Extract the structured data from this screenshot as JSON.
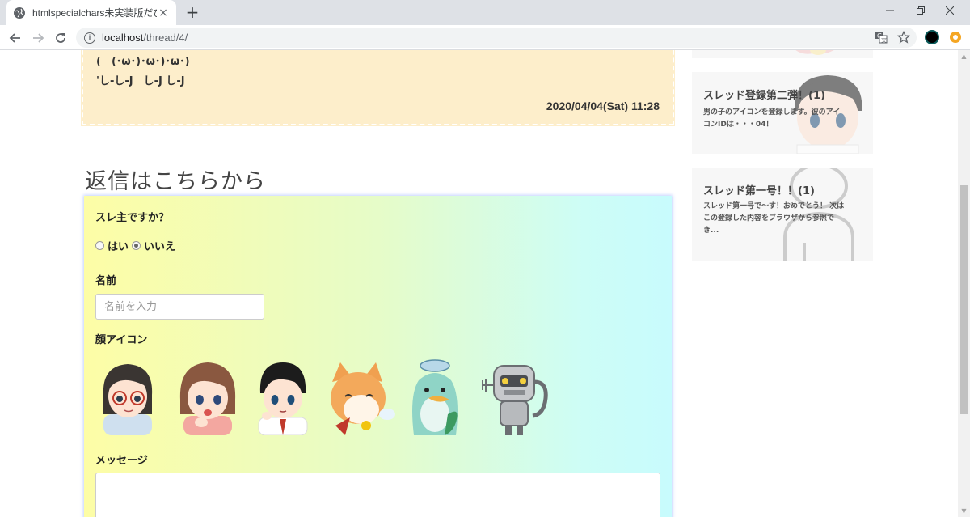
{
  "browser": {
    "tab_title": "htmlspecialchars未実装版だびぃ",
    "tab_close": "×",
    "new_tab": "+",
    "url_host": "localhost",
    "url_path": "/thread/4/",
    "icons": [
      "globe-icon",
      "back-icon",
      "forward-icon",
      "reload-icon",
      "info-icon",
      "translate-icon",
      "star-icon",
      "profile-icon",
      "extension-icon",
      "minimize-icon",
      "restore-icon",
      "close-icon"
    ]
  },
  "post": {
    "lines": [
      "(　(･ω･)･ω･)･ω･)",
      "'し-し-J　し-J し-J"
    ],
    "date": "2020/04/04(Sat) 11:28"
  },
  "reply": {
    "heading": "返信はこちらから",
    "owner_question": "スレ主ですか？",
    "radio_yes": "はい",
    "radio_no": "いいえ",
    "selected": "いいえ",
    "name_label": "名前",
    "name_placeholder": "名前を入力",
    "icon_label": "顔アイコン",
    "avatars": [
      "girl-glasses",
      "girl-brown-hair",
      "boy-black-hair",
      "orange-cat",
      "blue-bird",
      "robot"
    ],
    "message_label": "メッセージ"
  },
  "sidebar": {
    "cards": [
      {
        "title": "",
        "desc": ""
      },
      {
        "title": "スレッド登録第二弾！(1)",
        "desc": "男の子のアイコンを登録します。彼のアイコンIDは・・・04！"
      },
      {
        "title": "スレッド第一号！！(1)",
        "desc": "スレッド第一号で～す！おめでとう！ 次はこの登録した内容をブラウザから参照でき..."
      }
    ]
  },
  "colors": {
    "post_bg": "#fdeecb",
    "form_gradient_start": "#fdfda6",
    "form_gradient_end": "#c8fbfd",
    "tab_bar": "#dee1e6"
  }
}
